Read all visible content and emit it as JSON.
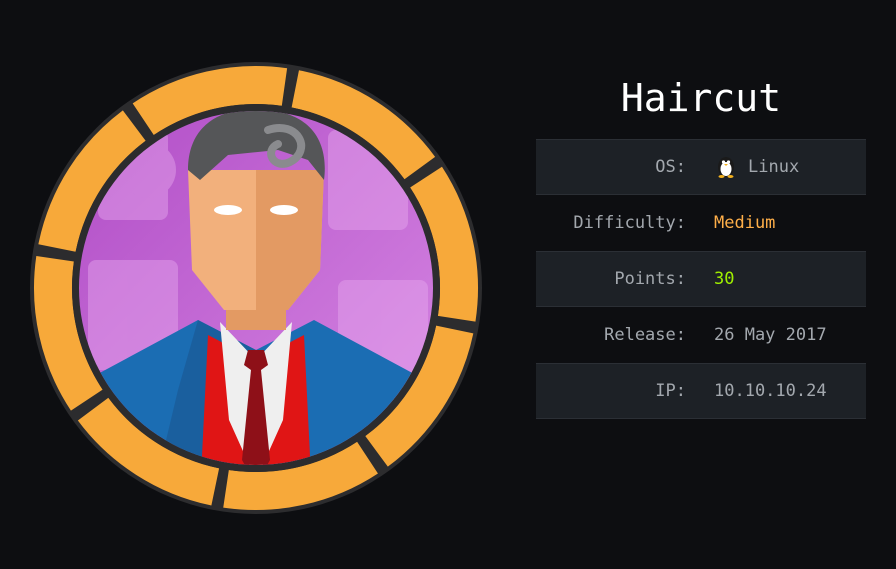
{
  "machine": {
    "name": "Haircut",
    "os_label": "OS:",
    "os": "Linux",
    "os_icon": "tux-penguin-icon",
    "difficulty_label": "Difficulty:",
    "difficulty": "Medium",
    "points_label": "Points:",
    "points": "30",
    "release_label": "Release:",
    "release": "26 May 2017",
    "ip_label": "IP:",
    "ip": "10.10.10.24"
  },
  "colors": {
    "background": "#0d0e11",
    "ring": "#f7a93a",
    "ring_dark": "#2c2c2e",
    "medium": "#ffaf49",
    "points": "#9fef00",
    "row_shaded": "#1d2126"
  }
}
